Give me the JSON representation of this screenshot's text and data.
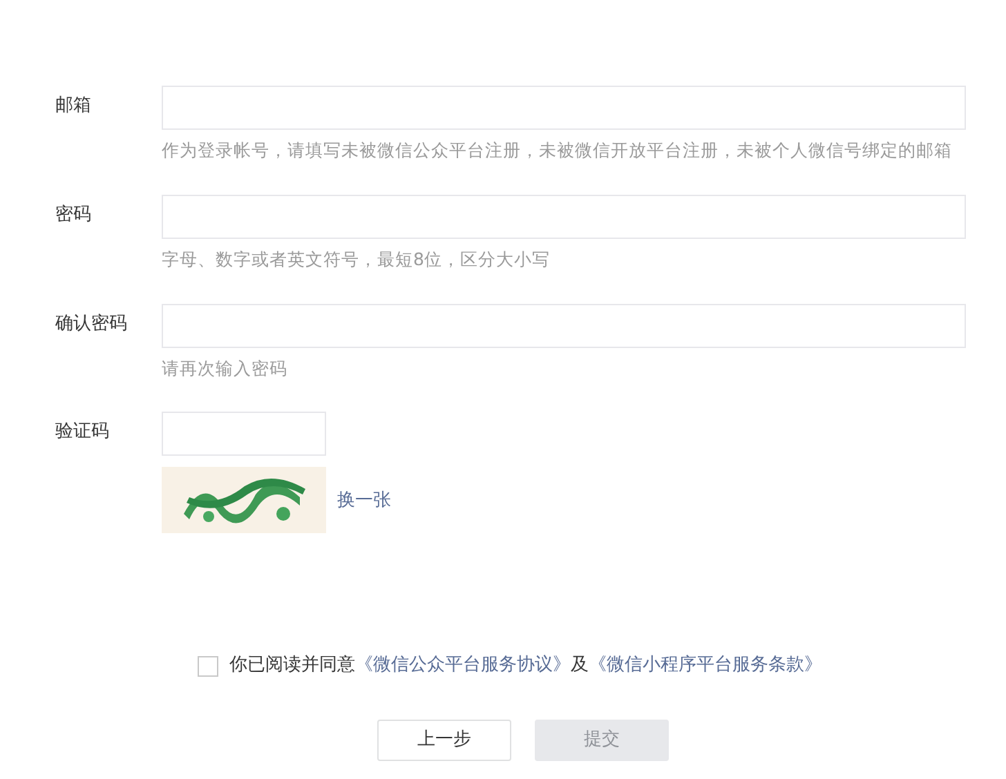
{
  "fields": [
    {
      "label": "邮箱",
      "kind": "text",
      "hint": "作为登录帐号，请填写未被微信公众平台注册，未被微信开放平台注册，未被个人微信号绑定的邮箱"
    },
    {
      "label": "密码",
      "kind": "text",
      "hint": "字母、数字或者英文符号，最短8位，区分大小写"
    },
    {
      "label": "确认密码",
      "kind": "text",
      "hint": "请再次输入密码"
    },
    {
      "label": "验证码",
      "kind": "captcha",
      "refresh_link": "换一张"
    }
  ],
  "agreement": {
    "checked": false,
    "segments": [
      {
        "kind": "plain",
        "text": "你已阅读并同意"
      },
      {
        "kind": "link",
        "text": "《微信公众平台服务协议》"
      },
      {
        "kind": "plain",
        "text": "及"
      },
      {
        "kind": "link",
        "text": "《微信小程序平台服务条款》"
      }
    ]
  },
  "buttons": [
    {
      "label": "上一步",
      "disabled": false
    },
    {
      "label": "提交",
      "disabled": true
    }
  ]
}
